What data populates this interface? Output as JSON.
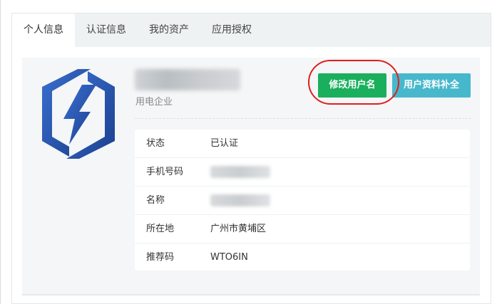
{
  "tabs": [
    {
      "label": "个人信息",
      "active": true
    },
    {
      "label": "认证信息",
      "active": false
    },
    {
      "label": "我的资产",
      "active": false
    },
    {
      "label": "应用授权",
      "active": false
    }
  ],
  "profile": {
    "subtitle": "用电企业",
    "buttons": {
      "edit_username": "修改用户名",
      "complete_profile": "用户资料补全"
    }
  },
  "info": {
    "rows": [
      {
        "label": "状态",
        "value": "已认证"
      },
      {
        "label": "手机号码",
        "value": ""
      },
      {
        "label": "名称",
        "value": ""
      },
      {
        "label": "所在地",
        "value": "广州市黄埔区"
      },
      {
        "label": "推荐码",
        "value": "WTO6IN"
      }
    ]
  },
  "colors": {
    "primary_button": "#1aaf5d",
    "secondary_button": "#47b8cc",
    "highlight": "#e01e1e",
    "logo": "#2355a8"
  },
  "icons": {
    "logo": "company-logo-icon"
  }
}
